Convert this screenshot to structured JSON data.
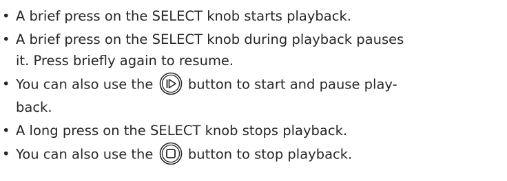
{
  "bullet_char": "•",
  "items": [
    {
      "lines": [
        "A brief press on the SELECT knob starts playback."
      ]
    },
    {
      "lines": [
        "A brief press on the SELECT knob during playback pauses",
        "it. Press briefly again to resume."
      ]
    },
    {
      "line1_before": "You can also use the",
      "line1_after": "button to start and pause play-",
      "line2": "back.",
      "icon": "play-pause-button-icon"
    },
    {
      "lines": [
        "A long press on the SELECT knob stops playback."
      ]
    },
    {
      "before": "You can also use the",
      "after": "button to stop playback.",
      "icon": "stop-button-icon"
    }
  ]
}
